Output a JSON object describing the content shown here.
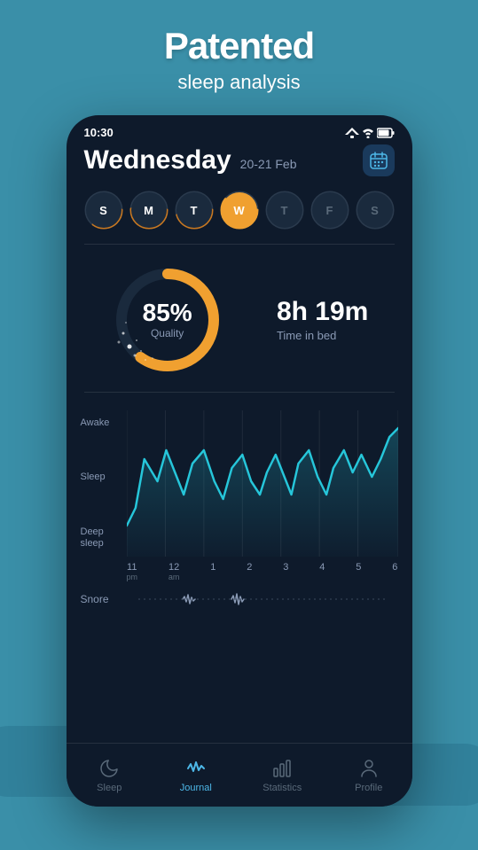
{
  "header": {
    "title": "Patented",
    "subtitle": "sleep analysis"
  },
  "status_bar": {
    "time": "10:30"
  },
  "day_header": {
    "day_name": "Wednesday",
    "date_range": "20-21 Feb"
  },
  "day_selector": {
    "days": [
      {
        "letter": "S",
        "has_data": true,
        "active": false
      },
      {
        "letter": "M",
        "has_data": true,
        "active": false
      },
      {
        "letter": "T",
        "has_data": true,
        "active": false
      },
      {
        "letter": "W",
        "has_data": true,
        "active": true
      },
      {
        "letter": "T",
        "has_data": false,
        "active": false
      },
      {
        "letter": "F",
        "has_data": false,
        "active": false
      },
      {
        "letter": "S",
        "has_data": false,
        "active": false
      }
    ]
  },
  "sleep_stats": {
    "quality_pct": "85%",
    "quality_label": "Quality",
    "time_in_bed": "8h 19m",
    "time_in_bed_label": "Time in bed"
  },
  "chart": {
    "y_labels": [
      "Awake",
      "Sleep",
      "Deep\nsleep"
    ],
    "x_labels": [
      {
        "main": "11",
        "sub": "pm"
      },
      {
        "main": "12",
        "sub": "am"
      },
      {
        "main": "1",
        "sub": ""
      },
      {
        "main": "2",
        "sub": ""
      },
      {
        "main": "3",
        "sub": ""
      },
      {
        "main": "4",
        "sub": ""
      },
      {
        "main": "5",
        "sub": ""
      },
      {
        "main": "6",
        "sub": ""
      }
    ]
  },
  "snore": {
    "label": "Snore"
  },
  "nav": {
    "items": [
      {
        "label": "Sleep",
        "icon": "moon",
        "active": false
      },
      {
        "label": "Journal",
        "icon": "wave",
        "active": true
      },
      {
        "label": "Statistics",
        "icon": "bar",
        "active": false
      },
      {
        "label": "Profile",
        "icon": "person",
        "active": false
      }
    ]
  },
  "colors": {
    "bg": "#3a8fa8",
    "phone_bg": "#0e1a2b",
    "accent_orange": "#f0a030",
    "accent_teal": "#4db8e8",
    "text_secondary": "#8a9ab5"
  }
}
